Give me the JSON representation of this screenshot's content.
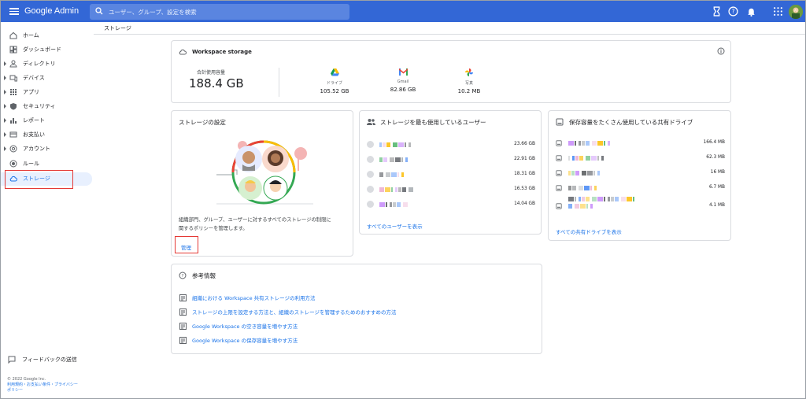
{
  "app": {
    "title": "Google Admin",
    "search_placeholder": "ユーザー、グループ、設定を検索"
  },
  "sidebar": {
    "items": [
      {
        "label": "ホーム",
        "icon": "home-icon"
      },
      {
        "label": "ダッシュボード",
        "icon": "dashboard-icon"
      },
      {
        "label": "ディレクトリ",
        "icon": "person-icon"
      },
      {
        "label": "デバイス",
        "icon": "devices-icon"
      },
      {
        "label": "アプリ",
        "icon": "apps-grid-icon"
      },
      {
        "label": "セキュリティ",
        "icon": "shield-icon"
      },
      {
        "label": "レポート",
        "icon": "bar-chart-icon"
      },
      {
        "label": "お支払い",
        "icon": "credit-card-icon"
      },
      {
        "label": "アカウント",
        "icon": "at-sign-icon"
      },
      {
        "label": "ルール",
        "icon": "rules-icon"
      },
      {
        "label": "ストレージ",
        "icon": "cloud-icon"
      }
    ],
    "feedback": "フィードバックの送信",
    "copyright": "© 2022 Google Inc.",
    "footer_links_1": "利用規約・お支払い条件・プライバシー",
    "footer_links_2": "ポリシー"
  },
  "breadcrumb": "ストレージ",
  "workspace_storage": {
    "title": "Workspace storage",
    "total_label": "合計使用容量",
    "total_value": "188.4 GB",
    "services": [
      {
        "name": "ドライブ",
        "value": "105.52 GB",
        "icon": "google-drive-icon"
      },
      {
        "name": "Gmail",
        "value": "82.86 GB",
        "icon": "gmail-icon"
      },
      {
        "name": "写真",
        "value": "10.2 MB",
        "icon": "google-photos-icon"
      }
    ]
  },
  "storage_settings": {
    "title": "ストレージの設定",
    "description_1": "組織部門、グループ、ユーザーに対するすべてのストレージの制限に",
    "description_2": "関するポリシーを管理します。",
    "manage": "管理"
  },
  "top_users": {
    "title": "ストレージを最も使用しているユーザー",
    "values": [
      "23.66 GB",
      "22.91 GB",
      "18.31 GB",
      "16.53 GB",
      "14.04 GB"
    ],
    "link": "すべてのユーザーを表示"
  },
  "shared_drives": {
    "title": "保存容量をたくさん使用している共有ドライブ",
    "values": [
      "166.4 MB",
      "62.3 MB",
      "16 MB",
      "6.7 MB",
      "4.1 MB"
    ],
    "link": "すべての共有ドライブを表示"
  },
  "references": {
    "title": "参考情報",
    "links": [
      "組織における Workspace 共有ストレージの利用方法",
      "ストレージの上限を設定する方法と、組織のストレージを管理するためのおすすめの方法",
      "Google Workspace の空き容量を増やす方法",
      "Google Workspace の保存容量を増やす方法"
    ]
  },
  "colors": {
    "topbar": "#3367d6",
    "link": "#1a73e8",
    "highlight": "#e53935"
  }
}
